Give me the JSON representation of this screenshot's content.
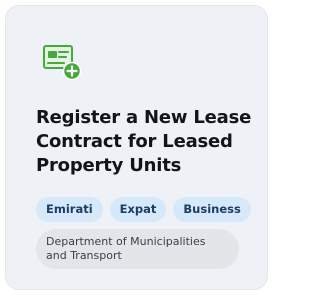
{
  "service_card": {
    "icon": "contract-add-icon",
    "title": "Register a New Lease Contract for Leased Property Units",
    "tags": [
      "Emirati",
      "Expat",
      "Business"
    ],
    "department": "Department of Municipalities and Transport"
  },
  "colors": {
    "card_background": "#eef1f5",
    "icon_green": "#47a83e",
    "tag_background": "#d6e9fb",
    "tag_text": "#1e3d64",
    "department_background": "#e3e5e8"
  }
}
